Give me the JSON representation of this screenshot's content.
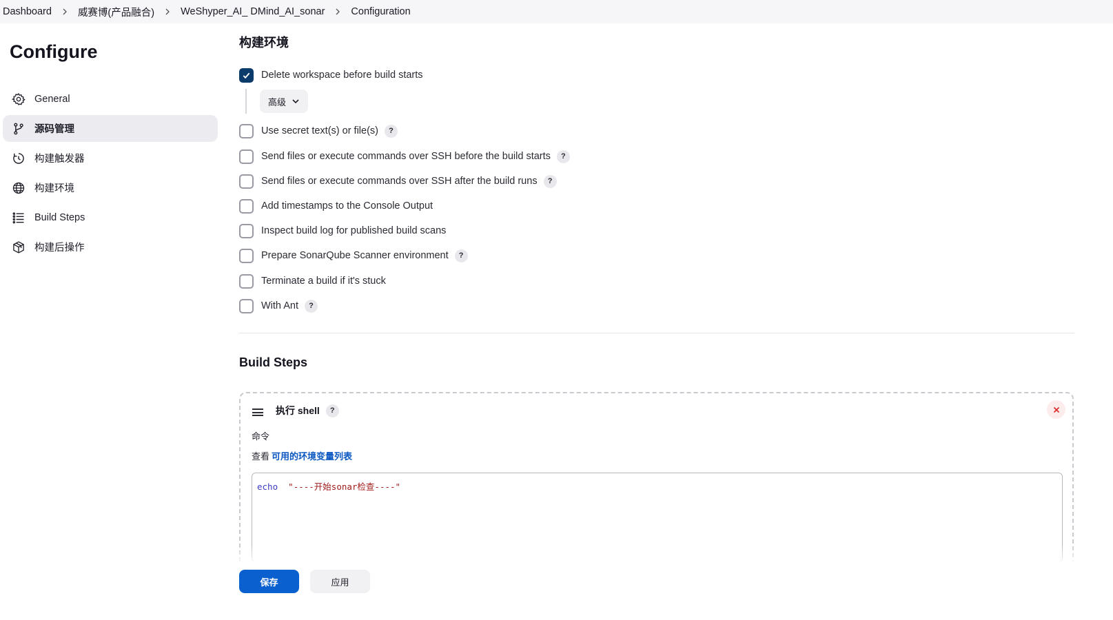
{
  "breadcrumb": [
    {
      "label": "Dashboard"
    },
    {
      "label": "威赛博(产品融合)"
    },
    {
      "label": "WeShyper_AI_ DMind_AI_sonar"
    },
    {
      "label": "Configuration"
    }
  ],
  "sidebar": {
    "title": "Configure",
    "items": [
      {
        "label": "General",
        "icon": "gear-icon",
        "active": false
      },
      {
        "label": "源码管理",
        "icon": "branch-icon",
        "active": true
      },
      {
        "label": "构建触发器",
        "icon": "clock-icon",
        "active": false
      },
      {
        "label": "构建环境",
        "icon": "globe-icon",
        "active": false
      },
      {
        "label": "Build Steps",
        "icon": "list-icon",
        "active": false
      },
      {
        "label": "构建后操作",
        "icon": "package-icon",
        "active": false
      }
    ]
  },
  "build_env": {
    "title": "构建环境",
    "advanced_label": "高级",
    "options": [
      {
        "label": "Delete workspace before build starts",
        "checked": true,
        "help": false
      },
      {
        "label": "Use secret text(s) or file(s)",
        "checked": false,
        "help": true
      },
      {
        "label": "Send files or execute commands over SSH before the build starts",
        "checked": false,
        "help": true
      },
      {
        "label": "Send files or execute commands over SSH after the build runs",
        "checked": false,
        "help": true
      },
      {
        "label": "Add timestamps to the Console Output",
        "checked": false,
        "help": false
      },
      {
        "label": "Inspect build log for published build scans",
        "checked": false,
        "help": false
      },
      {
        "label": "Prepare SonarQube Scanner environment",
        "checked": false,
        "help": true
      },
      {
        "label": "Terminate a build if it's stuck",
        "checked": false,
        "help": false
      },
      {
        "label": "With Ant",
        "checked": false,
        "help": true
      }
    ]
  },
  "build_steps": {
    "title": "Build Steps",
    "step": {
      "title": "执行 shell",
      "command_label": "命令",
      "env_prefix": "查看",
      "env_link": "可用的环境变量列表",
      "code_keyword": "echo",
      "code_string": "\"----开始sonar检查----\""
    }
  },
  "help_glyph": "?",
  "actions": {
    "save": "保存",
    "apply": "应用"
  },
  "colors": {
    "accent": "#0b60d0",
    "checked": "#0b3b6b",
    "link": "#0b57c2",
    "danger": "#d92626"
  }
}
